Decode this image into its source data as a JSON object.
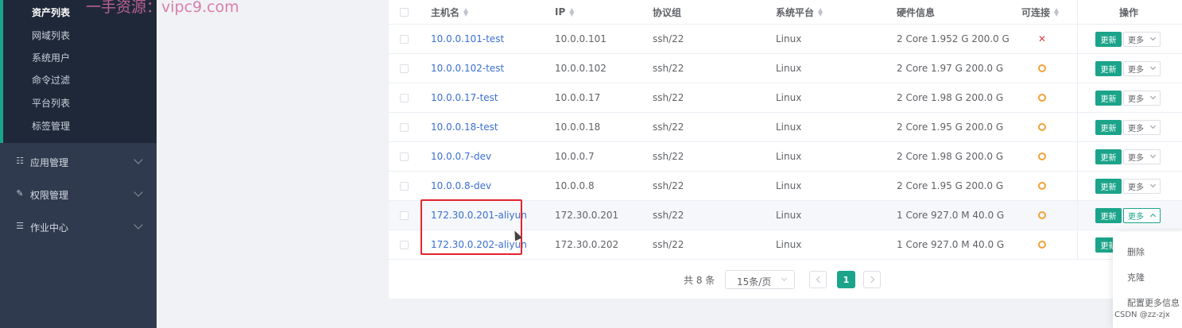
{
  "watermark": "一手资源：vipc9.com",
  "sidebar": {
    "submenu": [
      {
        "label": "资产列表",
        "active": true
      },
      {
        "label": "网域列表"
      },
      {
        "label": "系统用户"
      },
      {
        "label": "命令过滤"
      },
      {
        "label": "平台列表"
      },
      {
        "label": "标签管理"
      }
    ],
    "groups": [
      {
        "label": "应用管理",
        "icon": "grid-icon"
      },
      {
        "label": "权限管理",
        "icon": "edit-icon"
      },
      {
        "label": "作业中心",
        "icon": "list-icon"
      }
    ]
  },
  "table": {
    "headers": {
      "hostname": "主机名",
      "ip": "IP",
      "protocol": "协议组",
      "platform": "系统平台",
      "hardware": "硬件信息",
      "connectable": "可连接",
      "actions": "操作"
    },
    "rows": [
      {
        "hostname": "10.0.0.101-test",
        "ip": "10.0.0.101",
        "protocol": "ssh/22",
        "platform": "Linux",
        "hardware": "2 Core 1.952 G 200.0 G",
        "status": "fail"
      },
      {
        "hostname": "10.0.0.102-test",
        "ip": "10.0.0.102",
        "protocol": "ssh/22",
        "platform": "Linux",
        "hardware": "2 Core 1.97 G 200.0 G",
        "status": "unknown"
      },
      {
        "hostname": "10.0.0.17-test",
        "ip": "10.0.0.17",
        "protocol": "ssh/22",
        "platform": "Linux",
        "hardware": "2 Core 1.98 G 200.0 G",
        "status": "unknown"
      },
      {
        "hostname": "10.0.0.18-test",
        "ip": "10.0.0.18",
        "protocol": "ssh/22",
        "platform": "Linux",
        "hardware": "2 Core 1.95 G 200.0 G",
        "status": "unknown"
      },
      {
        "hostname": "10.0.0.7-dev",
        "ip": "10.0.0.7",
        "protocol": "ssh/22",
        "platform": "Linux",
        "hardware": "2 Core 1.98 G 200.0 G",
        "status": "unknown"
      },
      {
        "hostname": "10.0.0.8-dev",
        "ip": "10.0.0.8",
        "protocol": "ssh/22",
        "platform": "Linux",
        "hardware": "2 Core 1.95 G 200.0 G",
        "status": "unknown"
      },
      {
        "hostname": "172.30.0.201-aliyun",
        "ip": "172.30.0.201",
        "protocol": "ssh/22",
        "platform": "Linux",
        "hardware": "1 Core 927.0 M 40.0 G",
        "status": "unknown"
      },
      {
        "hostname": "172.30.0.202-aliyun",
        "ip": "172.30.0.202",
        "protocol": "ssh/22",
        "platform": "Linux",
        "hardware": "1 Core 927.0 M 40.0 G",
        "status": "unknown"
      }
    ],
    "update_label": "更新",
    "more_label": "更多"
  },
  "pagination": {
    "total": "共 8 条",
    "page_size": "15条/页",
    "current_page": "1"
  },
  "dropdown_menu": [
    "删除",
    "克隆",
    "配置更多信息"
  ],
  "footer_watermark": "CSDN @zz-zjx"
}
